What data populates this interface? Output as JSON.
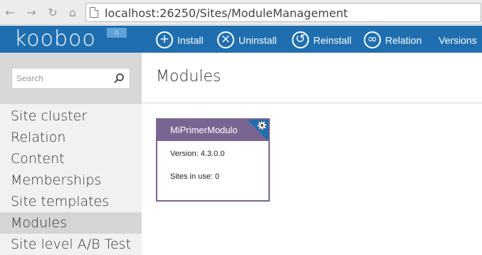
{
  "browser": {
    "url": "localhost:26250/Sites/ModuleManagement"
  },
  "app": {
    "logo": "kooboo",
    "toolbar": [
      {
        "label": "Install",
        "icon": "plus-circle-icon"
      },
      {
        "label": "Uninstall",
        "icon": "x-circle-icon"
      },
      {
        "label": "Reinstall",
        "icon": "refresh-circle-icon"
      },
      {
        "label": "Relation",
        "icon": "link-circle-icon"
      },
      {
        "label": "Versions",
        "icon": ""
      }
    ]
  },
  "sidebar": {
    "search_placeholder": "Search",
    "items": [
      {
        "label": "Site cluster",
        "active": false
      },
      {
        "label": "Relation",
        "active": false
      },
      {
        "label": "Content",
        "active": false
      },
      {
        "label": "Memberships",
        "active": false
      },
      {
        "label": "Site templates",
        "active": false
      },
      {
        "label": "Modules",
        "active": true
      },
      {
        "label": "Site level A/B Test",
        "active": false
      }
    ]
  },
  "main": {
    "title": "Modules",
    "modules": [
      {
        "name": "MiPrimerModulo",
        "version_text": "Version: 4.3.0.0",
        "sites_text": "Sites in use: 0"
      }
    ]
  },
  "colors": {
    "topbar": "#1f6fb0",
    "card_accent": "#7a6592"
  }
}
